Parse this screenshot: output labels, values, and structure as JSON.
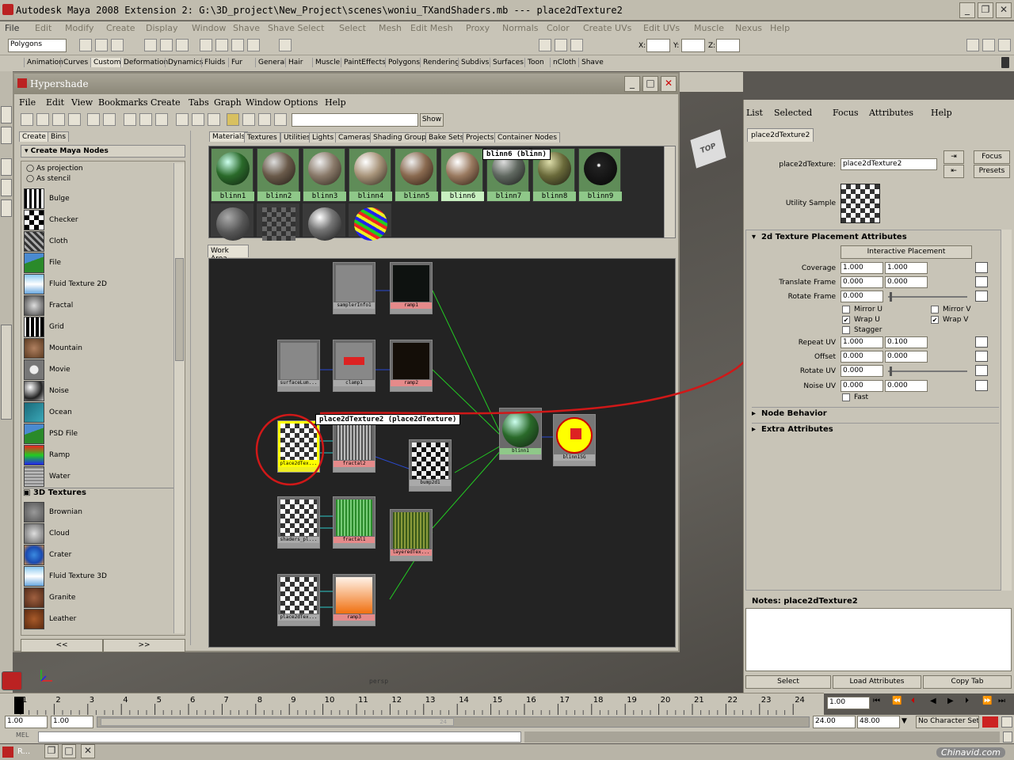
{
  "app": {
    "title": "Autodesk Maya 2008 Extension 2: G:\\3D_project\\New_Project\\scenes\\woniu_TXandShaders.mb   ---   place2dTexture2",
    "menu": [
      "File",
      "Edit",
      "Modify",
      "Create",
      "Display",
      "Window",
      "Shave",
      "Shave Select",
      "Select",
      "Mesh",
      "Edit Mesh",
      "Proxy",
      "Normals",
      "Color",
      "Create UVs",
      "Edit UVs",
      "Muscle",
      "Nexus",
      "Help"
    ],
    "mode_select": "Polygons",
    "coord_labels": {
      "x": "X:",
      "y": "Y:",
      "z": "Z:"
    },
    "shelf_tabs": [
      "Animation",
      "Curves",
      "Custom",
      "Deformation",
      "Dynamics",
      "Fluids",
      "Fur",
      "General",
      "Hair",
      "Muscle",
      "PaintEffects",
      "Polygons",
      "Rendering",
      "Subdivs",
      "Surfaces",
      "Toon",
      "nCloth",
      "Shave"
    ],
    "viewcube": "TOP",
    "camera_label": "persp"
  },
  "hypershade": {
    "title": "Hypershade",
    "menu": [
      "File",
      "Edit",
      "View",
      "Bookmarks",
      "Create",
      "Tabs",
      "Graph",
      "Window",
      "Options",
      "Help"
    ],
    "show_button": "Show",
    "create_tabs": [
      "Create",
      "Bins"
    ],
    "create_header": "Create Maya Nodes",
    "radio_options": [
      "As projection",
      "As stencil"
    ],
    "textures_2d": [
      "Bulge",
      "Checker",
      "Cloth",
      "File",
      "Fluid Texture 2D",
      "Fractal",
      "Grid",
      "Mountain",
      "Movie",
      "Noise",
      "Ocean",
      "PSD File",
      "Ramp",
      "Water"
    ],
    "textures_3d_header": "3D Textures",
    "textures_3d": [
      "Brownian",
      "Cloud",
      "Crater",
      "Fluid Texture 3D",
      "Granite",
      "Leather"
    ],
    "scroll_left": "<<",
    "scroll_right": ">>",
    "top_tabs": [
      "Materials",
      "Textures",
      "Utilities",
      "Lights",
      "Cameras",
      "Shading Groups",
      "Bake Sets",
      "Projects",
      "Container Nodes"
    ],
    "materials": [
      "blinn1",
      "blinn2",
      "blinn3",
      "blinn4",
      "blinn5",
      "blinn6",
      "blinn7",
      "blinn8",
      "blinn9"
    ],
    "tooltip_material": "blinn6 (blinn)",
    "work_tab": "Work Area",
    "graph_nodes": {
      "samplerInfo1": "samplerInfo1",
      "ramp1": "ramp1",
      "surfaceLum": "surfaceLum...",
      "clamp1": "clamp1",
      "ramp2": "ramp2",
      "place2dTex_sel": "place2dTex...",
      "fractal2": "fractal2",
      "bump2d1": "bump2d1",
      "blinn1": "blinn1",
      "blinn1SG": "blinn1SG",
      "shader_pl": "shaders_pl...",
      "fractal1": "fractal1",
      "layeredTex": "layeredTex...",
      "place2dTex2": "place2dTex...",
      "ramp3": "ramp3"
    },
    "graph_tooltip": "place2dTexture2 (place2dTexture)"
  },
  "attribute_editor": {
    "menu": [
      "List",
      "Selected",
      "Focus",
      "Attributes",
      "Help"
    ],
    "tab": "place2dTexture2",
    "type_label": "place2dTexture:",
    "name_value": "place2dTexture2",
    "focus": "Focus",
    "presets": "Presets",
    "sample_label": "Utility Sample",
    "section_title": "2d Texture Placement Attributes",
    "interactive": "Interactive Placement",
    "rows": {
      "coverage": {
        "label": "Coverage",
        "a": "1.000",
        "b": "1.000"
      },
      "translate": {
        "label": "Translate Frame",
        "a": "0.000",
        "b": "0.000"
      },
      "rotate_frame": {
        "label": "Rotate Frame",
        "a": "0.000"
      },
      "repeat": {
        "label": "Repeat UV",
        "a": "1.000",
        "b": "0.100"
      },
      "offset": {
        "label": "Offset",
        "a": "0.000",
        "b": "0.000"
      },
      "rotate_uv": {
        "label": "Rotate UV",
        "a": "0.000"
      },
      "noise": {
        "label": "Noise UV",
        "a": "0.000",
        "b": "0.000"
      }
    },
    "checks": {
      "mirror_u": "Mirror U",
      "mirror_v": "Mirror V",
      "wrap_u": "Wrap U",
      "wrap_v": "Wrap V",
      "stagger": "Stagger",
      "fast": "Fast"
    },
    "node_behavior": "Node Behavior",
    "extra": "Extra Attributes",
    "notes": "Notes:  place2dTexture2",
    "select": "Select",
    "load": "Load Attributes",
    "copy": "Copy Tab"
  },
  "time": {
    "ticks": [
      "1",
      "2",
      "3",
      "4",
      "5",
      "6",
      "7",
      "8",
      "9",
      "10",
      "11",
      "12",
      "13",
      "14",
      "15",
      "16",
      "17",
      "18",
      "19",
      "20",
      "21",
      "22",
      "23",
      "24"
    ],
    "current": "1.00",
    "start": "1.00",
    "start2": "1.00",
    "range_end": "24.00",
    "end": "48.00",
    "char_set": "No Character Set",
    "range_label": "24"
  },
  "cmd_label": "MEL",
  "taskbar": {
    "item": "R...",
    "watermark": "Chinavid.com"
  },
  "colors": {
    "annotation": "#d01818",
    "selected_node": "#ffff00"
  }
}
